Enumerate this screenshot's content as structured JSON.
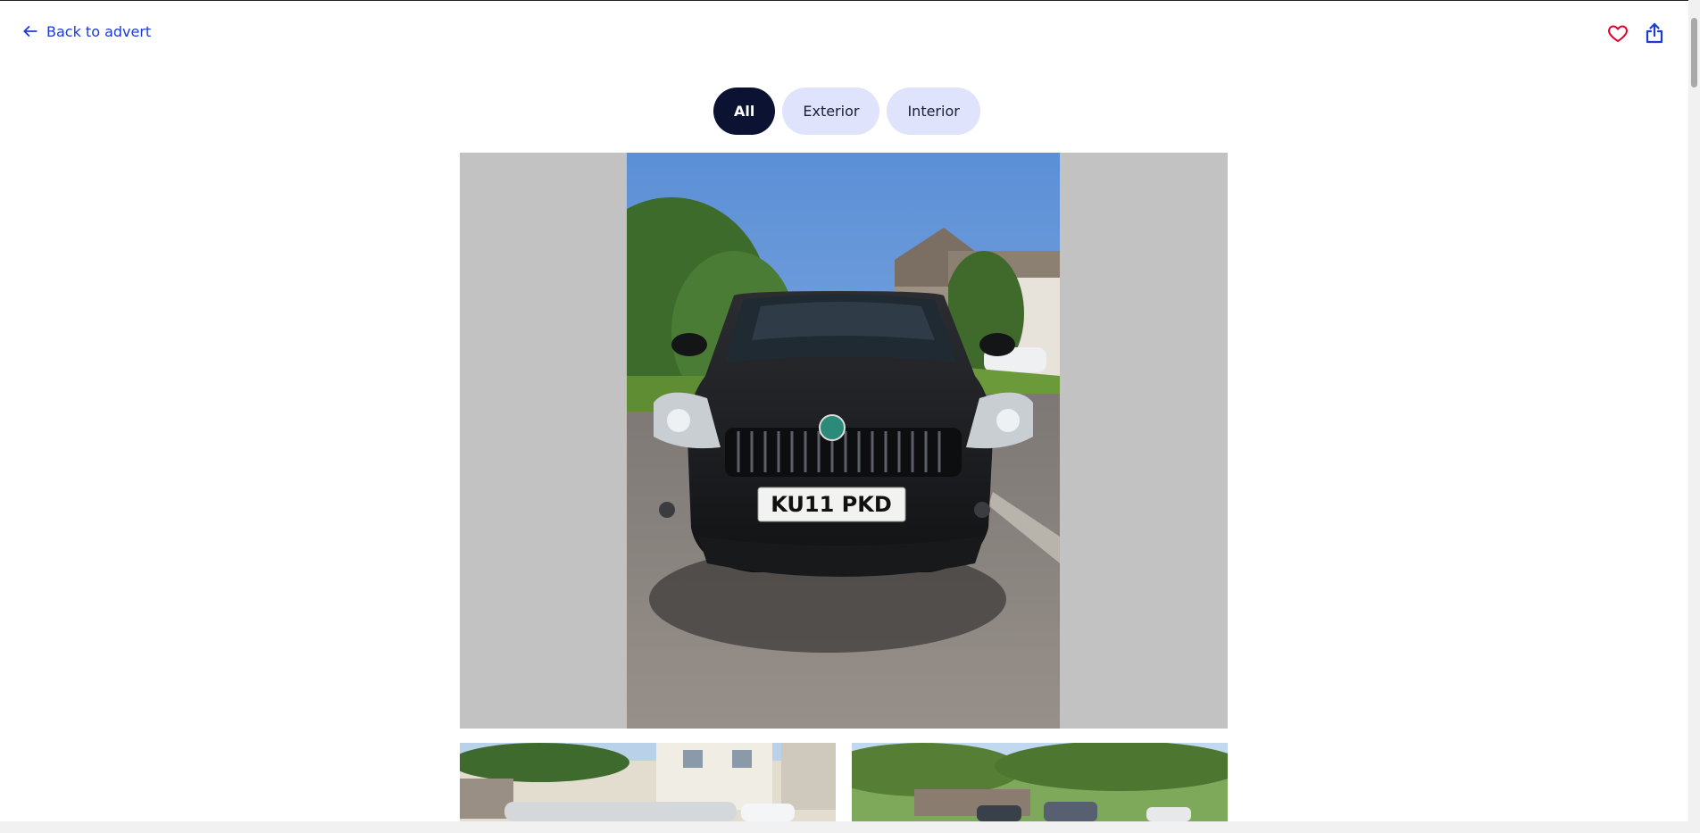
{
  "header": {
    "back_label": "Back to advert",
    "icons": [
      "arrow-left-icon",
      "heart-icon",
      "share-icon"
    ],
    "heart_color": "#e4002b",
    "link_color": "#1a3bd6"
  },
  "tabs": [
    {
      "label": "All",
      "active": true
    },
    {
      "label": "Exterior",
      "active": false
    },
    {
      "label": "Interior",
      "active": false
    }
  ],
  "main_photo": {
    "plate": "KU11 PKD"
  },
  "colors": {
    "tab_active_bg": "#0b1232",
    "tab_bg": "#dfe3fb",
    "gallery_bg": "#c2c2c2"
  }
}
